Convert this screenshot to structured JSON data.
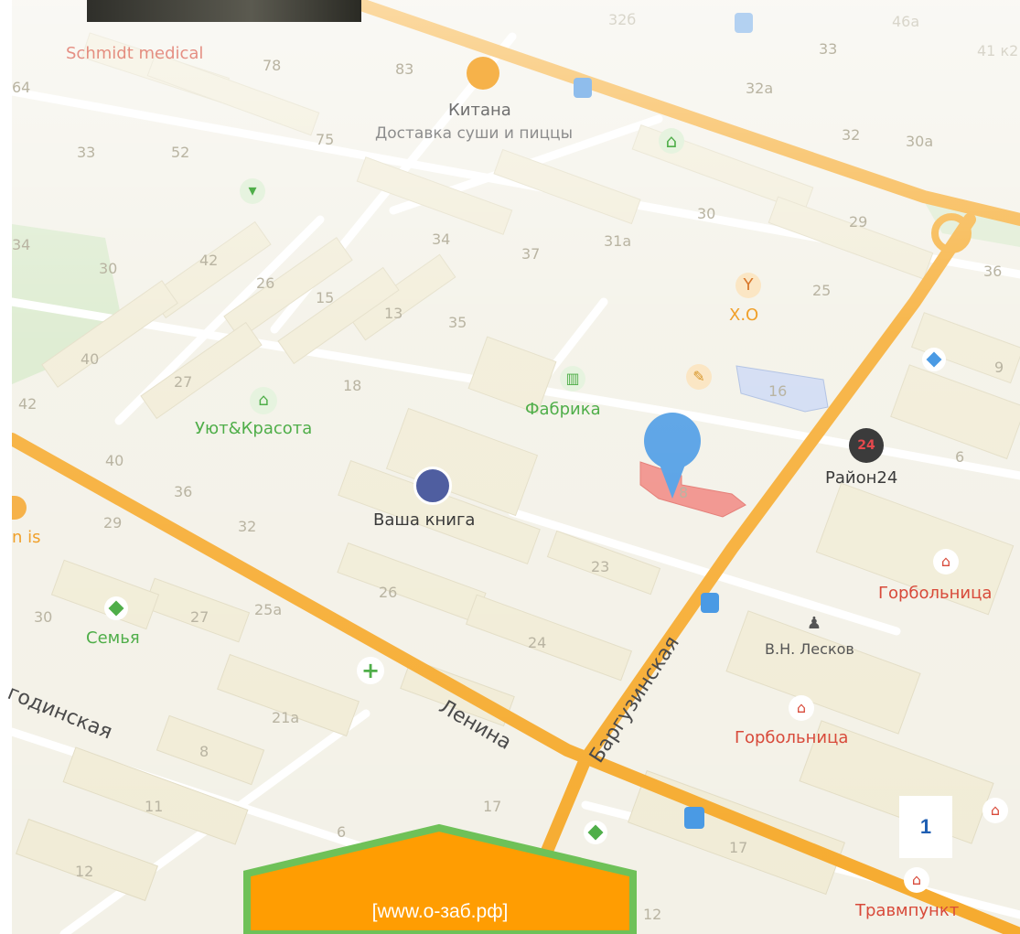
{
  "map": {
    "streets": [
      "Ленина",
      "Баргузинская",
      "годинская"
    ],
    "poi": {
      "schmidt": "Schmidt medical",
      "kitana_name": "Китана",
      "kitana_desc": "Доставка суши и пиццы",
      "xo": "Х.О",
      "fabrika": "Фабрика",
      "uyut": "Уют&Красота",
      "vasha_kniga": "Ваша книга",
      "rayon24": "Район24",
      "rayon24_icon_text": "24",
      "gorbolnitsa_1": "Горбольница",
      "gorbolnitsa_2": "Горбольница",
      "leskov": "В.Н. Лесков",
      "semya": "Семья",
      "travmpunkt": "Травмпункт",
      "n_is": "n is"
    },
    "house_numbers": {
      "h32b": "32б",
      "h46a": "46а",
      "h41k2": "41 к2",
      "h33top": "33",
      "h78": "78",
      "h83": "83",
      "h32a": "32а",
      "h64": "64",
      "h33left": "33",
      "h52": "52",
      "h75": "75",
      "h32": "32",
      "h30a": "30а",
      "h30mid": "30",
      "h29top": "29",
      "h34a": "34",
      "h34b": "34",
      "h37": "37",
      "h31a": "31а",
      "h30left": "30",
      "h42a": "42",
      "h26a": "26",
      "h15": "15",
      "h13": "13",
      "h35": "35",
      "h25": "25",
      "h36r": "36",
      "h40a": "40",
      "h27a": "27",
      "h18": "18",
      "h42b": "42",
      "h16": "16",
      "h9": "9",
      "h40b": "40",
      "h36l": "36",
      "h32l": "32",
      "h8": "8",
      "h6r": "6",
      "h29l": "29",
      "h23": "23",
      "h26b": "26",
      "h24": "24",
      "h30b": "30",
      "h27b": "27",
      "h25a": "25а",
      "h21a": "21а",
      "h8b": "8",
      "h11": "11",
      "h17a": "17",
      "h6b": "6",
      "h17b": "17",
      "h12a": "12",
      "h12b": "12"
    }
  },
  "overlay": {
    "page_badge": "1",
    "url_label": "[www.о-заб.рф]"
  },
  "colors": {
    "background": "#f3f1e7",
    "building": "#f1ecd6",
    "road_main": "#f6ab2f",
    "road_minor": "#ffffff",
    "park": "#cfe7c1",
    "selected_building": "#f08d86",
    "marker": "#4a9ae4",
    "badge_text": "#1f5fb3",
    "url_box": "#ff9d02",
    "url_box_border": "#6ec158"
  },
  "icons": [
    "cafe-icon",
    "hanger-icon",
    "basket-icon",
    "fork-knife-icon",
    "factory-icon",
    "pin-marker-icon",
    "book-icon",
    "24-icon",
    "hospital-icon",
    "person-icon",
    "pharmacy-cross-icon",
    "diamond-icon",
    "bus-stop-icon"
  ]
}
